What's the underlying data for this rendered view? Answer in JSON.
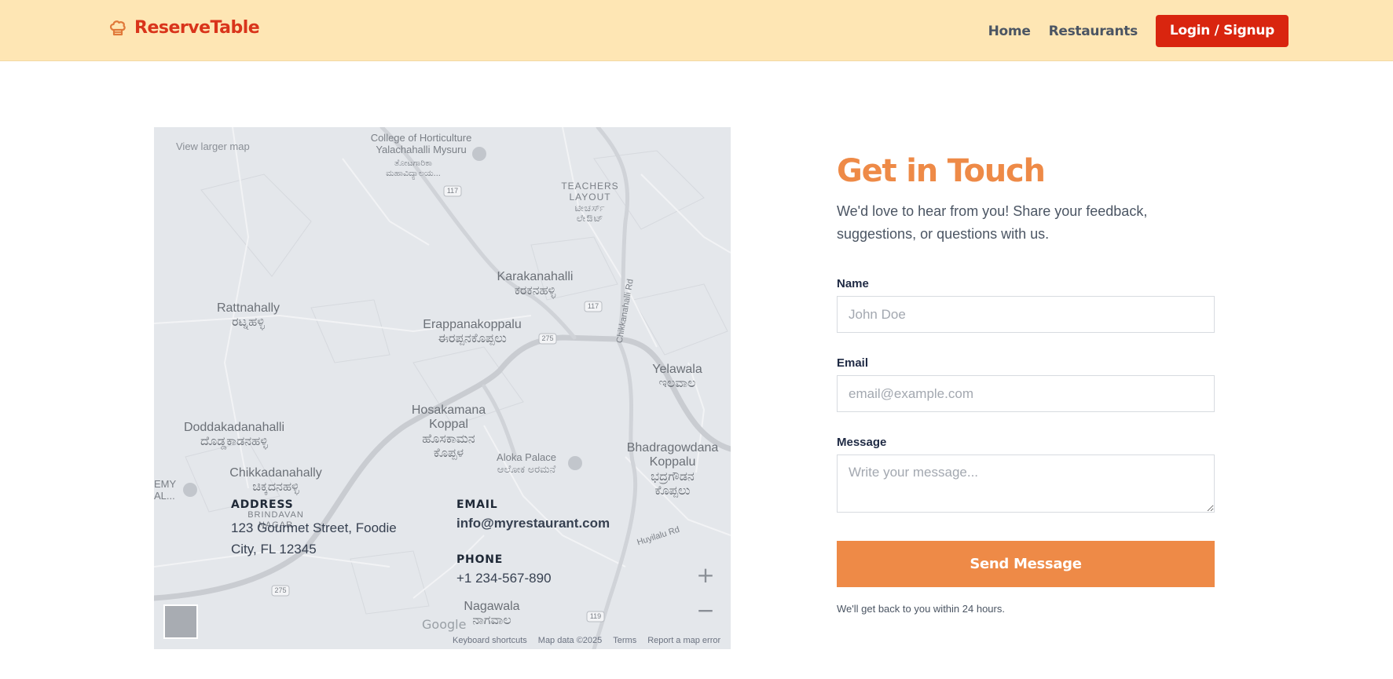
{
  "header": {
    "brand": "ReserveTable",
    "nav": [
      {
        "label": "Home"
      },
      {
        "label": "Restaurants"
      }
    ],
    "login_label": "Login / Signup"
  },
  "map": {
    "larger_map_link": "View larger map",
    "places": [
      {
        "id": "college",
        "text": "College of Horticulture\nYalachahalli Mysuru"
      },
      {
        "id": "college-kn",
        "text": "ತೋಟಗಾರಿಕಾ\nಮಹಾವಿದ್ಯಾಲಯ..."
      },
      {
        "id": "teachers",
        "text": "TEACHERS\nLAYOUT\nಟೀಚರ್ಸ್\nಲೇಔಟ್"
      },
      {
        "id": "karakanahalli",
        "text": "Karakanahalli\nಕರಕನಹಳ್ಳಿ"
      },
      {
        "id": "rattnahally",
        "text": "Rattnahally\nರಟ್ನಹಳ್ಳಿ"
      },
      {
        "id": "erappanakoppalu",
        "text": "Erappanakoppalu\nಈರಪ್ಪನಕೊಪ್ಪಲು"
      },
      {
        "id": "yelawala",
        "text": "Yelawala\nಇಲವಾಲ"
      },
      {
        "id": "hosakamana",
        "text": "Hosakamana\nKoppal\nಹೊಸಕಾಮನ\nಕೊಪ್ಪಳ"
      },
      {
        "id": "doddakadanahalli",
        "text": "Doddakadanahalli\nದೊಡ್ಡಕಾಡನಹಳ್ಳಿ"
      },
      {
        "id": "aloka",
        "text": "Aloka Palace\nಆಲೋಕ ಅರಮನೆ"
      },
      {
        "id": "bhadragowdana",
        "text": "Bhadragowdana\nKoppalu\nಭದ್ರಗೌಡನ\nಕೊಪ್ಪಲು"
      },
      {
        "id": "chikkadanahally",
        "text": "Chikkadanahally\nಚಿಕ್ಕದನಹಳ್ಳಿ"
      },
      {
        "id": "brindavan",
        "text": "BRINDAVAN\nNAGAR"
      },
      {
        "id": "nagawala",
        "text": "Nagawala\nನಾಗವಾಲ"
      },
      {
        "id": "chikkanahalli-rd",
        "text": "Chikkanahalli Rd"
      },
      {
        "id": "huyilalu-rd",
        "text": "Huyilalu Rd"
      },
      {
        "id": "emy",
        "text": "EMY\nAL..."
      }
    ],
    "road_shields": [
      "117",
      "117",
      "275",
      "119",
      "275"
    ],
    "google": "Google",
    "attribution": [
      "Keyboard shortcuts",
      "Map data ©2025",
      "Terms",
      "Report a map error"
    ],
    "zoom_in": "+",
    "zoom_out": "−"
  },
  "contact": {
    "address_title": "ADDRESS",
    "address_value": "123 Gourmet Street, Foodie City, FL 12345",
    "email_title": "EMAIL",
    "email_value": "info@myrestaurant.com",
    "phone_title": "PHONE",
    "phone_value": "+1 234-567-890"
  },
  "form": {
    "title": "Get in Touch",
    "subtitle": "We'd love to hear from you! Share your feedback, suggestions, or questions with us.",
    "name_label": "Name",
    "name_placeholder": "John Doe",
    "email_label": "Email",
    "email_placeholder": "email@example.com",
    "message_label": "Message",
    "message_placeholder": "Write your message...",
    "submit_label": "Send Message",
    "note": "We'll get back to you within 24 hours."
  },
  "colors": {
    "header_bg": "#fee6b4",
    "brand": "#d9341b",
    "login_bg": "#d9250f",
    "accent": "#ee8a47"
  }
}
